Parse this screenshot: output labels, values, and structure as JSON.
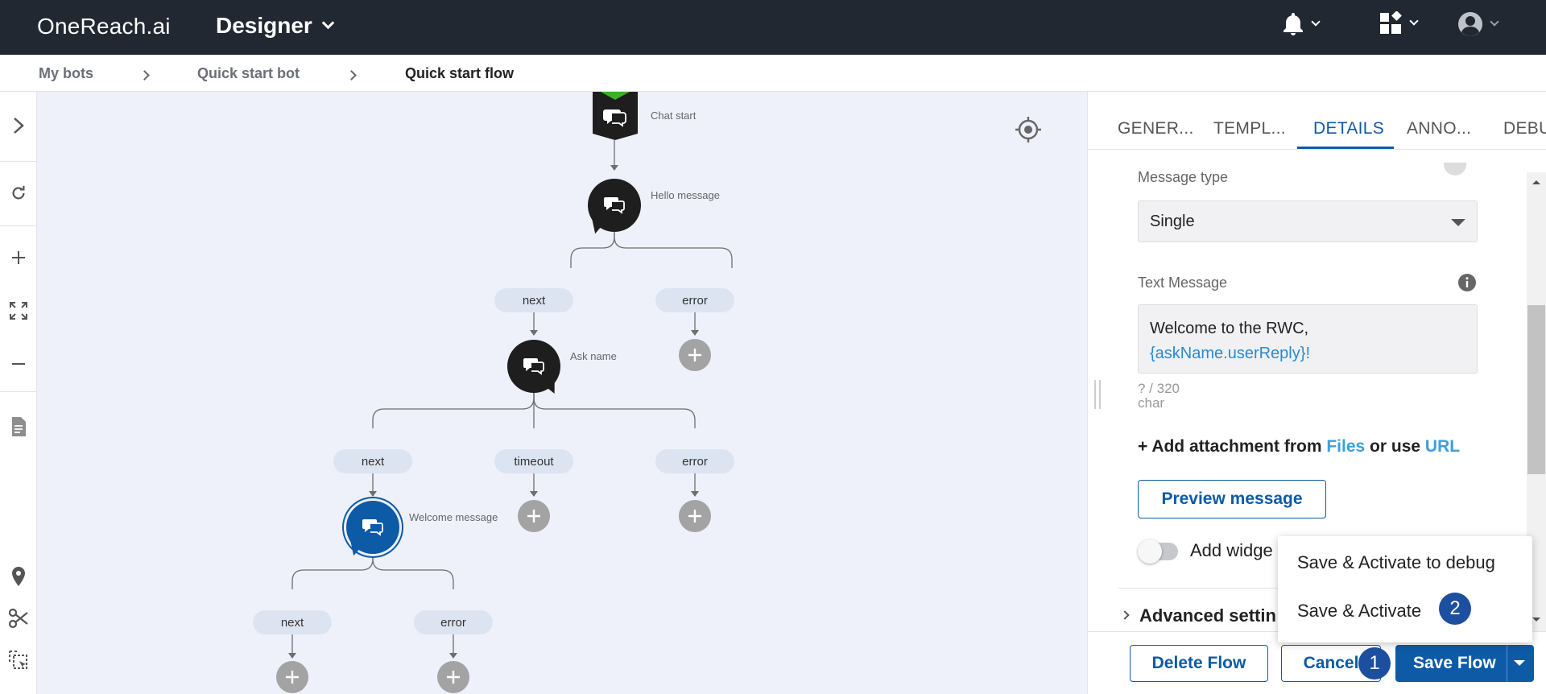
{
  "topbar": {
    "logo": "OneReach.ai",
    "app_title": "Designer",
    "icons": [
      "bell-icon",
      "apps-icon",
      "user-icon"
    ]
  },
  "breadcrumb": {
    "items": [
      "My bots",
      "Quick start bot",
      "Quick start flow"
    ]
  },
  "flow": {
    "nodes": {
      "chat_start": "Chat start",
      "hello": "Hello message",
      "ask": "Ask name",
      "welcome": "Welcome message"
    },
    "branches": {
      "hello_next": "next",
      "hello_error": "error",
      "ask_next": "next",
      "ask_timeout": "timeout",
      "ask_error": "error",
      "welcome_next": "next",
      "welcome_error": "error"
    }
  },
  "panel": {
    "tabs": [
      "GENER...",
      "TEMPL...",
      "DETAILS",
      "ANNO...",
      "DEBU"
    ],
    "active_tab": "DETAILS",
    "message_type_label": "Message type",
    "message_type_value": "Single",
    "text_message_label": "Text Message",
    "text_message_line1": "Welcome to the RWC,",
    "text_message_var": "{askName.userReply}",
    "text_message_end": "!",
    "counter_line1": "? / 320",
    "counter_line2": "char",
    "attach_prefix": "+ Add attachment from ",
    "attach_files": "Files",
    "attach_middle": " or use ",
    "attach_url": "URL",
    "preview_button": "Preview message",
    "add_widget_label": "Add widge",
    "advanced_label": "Advanced settin"
  },
  "footer": {
    "delete_button": "Delete Flow",
    "cancel_button": "Cancel",
    "save_button": "Save Flow"
  },
  "save_menu": {
    "items": [
      "Save & Activate to debug",
      "Save & Activate"
    ]
  },
  "badges": [
    "1",
    "2"
  ],
  "colors": {
    "topbar": "#222831",
    "primary": "#0d5aa7",
    "canvas": "#eef1fa",
    "node": "#1e1e1e",
    "selected_node": "#0d5aa7",
    "link": "#3a9fe0"
  }
}
